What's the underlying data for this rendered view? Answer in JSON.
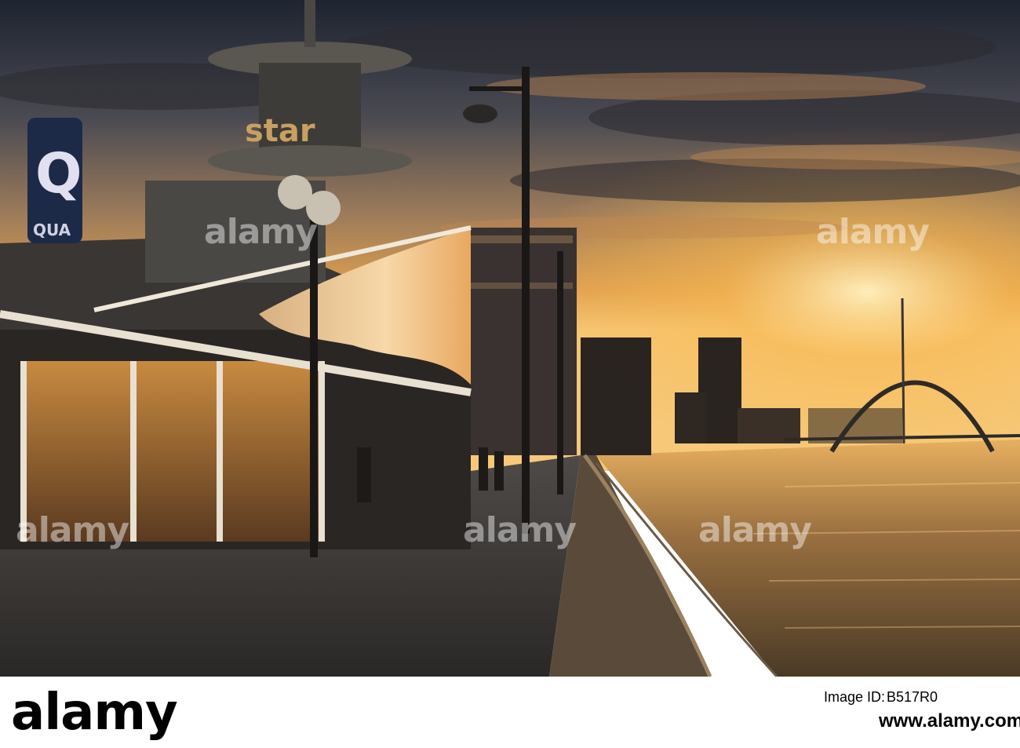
{
  "scene": {
    "description_tags": [
      "riverside walkway",
      "sunset",
      "arch bridge",
      "lamp posts",
      "building"
    ],
    "sign_letters": "QUA",
    "tower_letters": "star"
  },
  "watermark": "alamy",
  "footer": {
    "logo": "alamy",
    "image_id_label": "Image ID:",
    "image_id": "B517R0",
    "site": "www.alamy.com"
  },
  "colors": {
    "sky_top": "#1b2230",
    "sky_glow": "#f0a040",
    "water": "#7a5a30",
    "footer_bg": "#ffffff"
  }
}
